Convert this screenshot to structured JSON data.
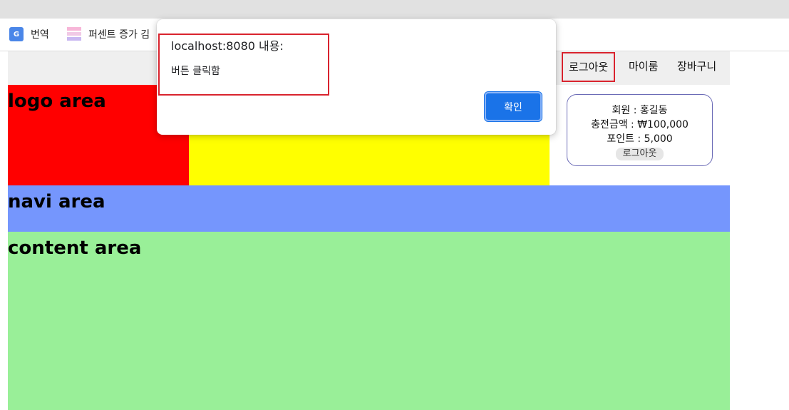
{
  "bookmarks": [
    {
      "label": "번역",
      "icon": "google-translate-icon"
    },
    {
      "label": "퍼센트 증가 김",
      "icon": "percent-bars-icon"
    }
  ],
  "topnav": {
    "logout": "로그아웃",
    "mypage": "마이룸",
    "cart": "장바구니"
  },
  "areas": {
    "logo": "logo area",
    "navi": "navi area",
    "content": "content area"
  },
  "member": {
    "name": "회원 : 홍길동",
    "charge": "충전금액 : ₩100,000",
    "point": "포인트 : 5,000",
    "logout": "로그아웃"
  },
  "dialog": {
    "origin": "localhost:8080 내용:",
    "message": "버튼 클릭함",
    "ok": "확인"
  },
  "colors": {
    "logo_bg": "#ff0000",
    "banner_bg": "#ffff00",
    "navi_bg": "#7596fd",
    "content_bg": "#99ef98",
    "highlight": "#d9232e",
    "ok_button": "#1a73e8"
  }
}
